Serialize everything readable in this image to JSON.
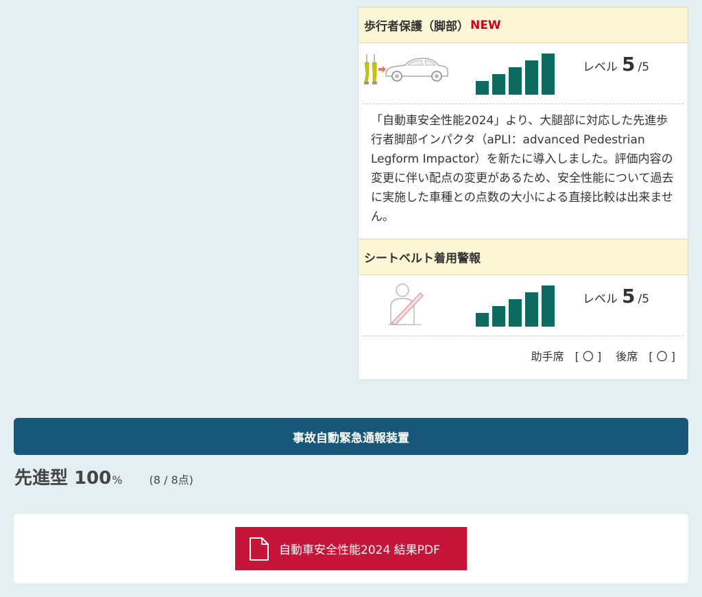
{
  "pedestrian_leg": {
    "title": "歩行者保護（脚部）",
    "badge": "NEW",
    "level_label": "レベル",
    "level": 5,
    "level_max": "/5",
    "bar_count": 5,
    "description": "「自動車安全性能2024」より、大腿部に対応した先進歩行者脚部インパクタ（aPLI：advanced Pedestrian Legform Impactor）を新たに導入しました。評価内容の変更に伴い配点の変更があるため、安全性能について過去に実施した車種との点数の大小による直接比較は出来ません。"
  },
  "seatbelt_warning": {
    "title": "シートベルト着用警報",
    "level_label": "レベル",
    "level": 5,
    "level_max": "/5",
    "bar_count": 5,
    "seats_text": "助手席　[ 〇 ]　 後席　[ 〇 ]"
  },
  "eacn": {
    "title": "事故自動緊急通報装置",
    "result_type": "先進型",
    "result_value": "100",
    "result_unit": "%",
    "points": "(8 / 8点)"
  },
  "pdf_button": {
    "label": "自動車安全性能2024 結果PDF"
  },
  "colors": {
    "page_bg": "#e3eff0",
    "section_head_bg": "#fdf6d4",
    "bar_green": "#0e6b62",
    "header_blue": "#17577a",
    "pdf_red": "#c5163a",
    "new_red": "#d0021b"
  }
}
